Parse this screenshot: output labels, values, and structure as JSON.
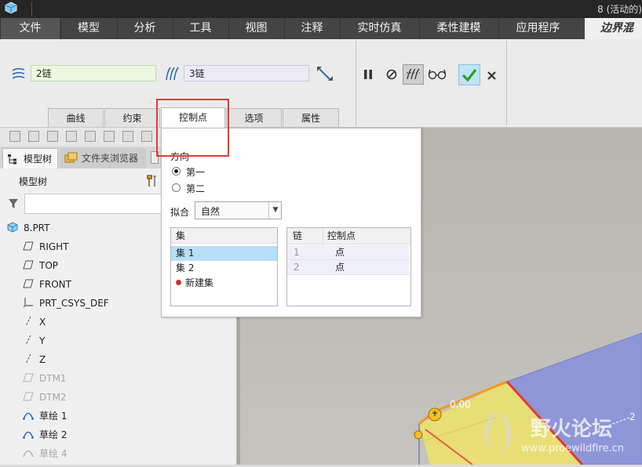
{
  "window": {
    "title": "8 (活动的)"
  },
  "ribbon": {
    "tabs": [
      "文件",
      "模型",
      "分析",
      "工具",
      "视图",
      "注释",
      "实时仿真",
      "柔性建模",
      "应用程序"
    ],
    "active_tab": "边界混合"
  },
  "boundary_blend": {
    "first_direction_chain": "2链",
    "second_direction_chain": "3链",
    "subtabs": [
      "曲线",
      "约束",
      "控制点",
      "选项",
      "属性"
    ],
    "active_subtab": "控制点"
  },
  "control_points_panel": {
    "direction_label": "方向",
    "direction_options": [
      "第一",
      "第二"
    ],
    "direction_selected": "第一",
    "fit_label": "拟合",
    "fit_value": "自然",
    "sets_header": "集",
    "sets": [
      "集 1",
      "集 2"
    ],
    "selected_set": "集 1",
    "new_set_label": "新建集",
    "table_headers": [
      "链",
      "控制点"
    ],
    "table_rows": [
      {
        "chain": "1",
        "point": "点"
      },
      {
        "chain": "2",
        "point": "点"
      }
    ]
  },
  "model_tree": {
    "tabs": [
      "模型树",
      "文件夹浏览器"
    ],
    "header": "模型树",
    "items": [
      {
        "label": "8.PRT",
        "icon": "part-icon"
      },
      {
        "label": "RIGHT",
        "icon": "datum-plane-icon"
      },
      {
        "label": "TOP",
        "icon": "datum-plane-icon"
      },
      {
        "label": "FRONT",
        "icon": "datum-plane-icon"
      },
      {
        "label": "PRT_CSYS_DEF",
        "icon": "coordinate-system-icon"
      },
      {
        "label": "X",
        "icon": "datum-axis-icon"
      },
      {
        "label": "Y",
        "icon": "datum-axis-icon"
      },
      {
        "label": "Z",
        "icon": "datum-axis-icon"
      },
      {
        "label": "DTM1",
        "icon": "datum-plane-icon"
      },
      {
        "label": "DTM2",
        "icon": "datum-plane-icon"
      },
      {
        "label": "草绘 1",
        "icon": "sketch-icon"
      },
      {
        "label": "草绘 2",
        "icon": "sketch-icon"
      },
      {
        "label": "草绘 4",
        "icon": "sketch-icon"
      }
    ]
  },
  "viewport": {
    "dimension_value": "0.00",
    "label_2": "2",
    "watermark_title": "野火论坛",
    "watermark_url": "www.proewildfire.cn"
  },
  "colors": {
    "surface": "#8f96d8",
    "highlight_edge": "#e53935",
    "yellow_preview": "#f0e060",
    "confirm_green": "#2aa02a"
  }
}
